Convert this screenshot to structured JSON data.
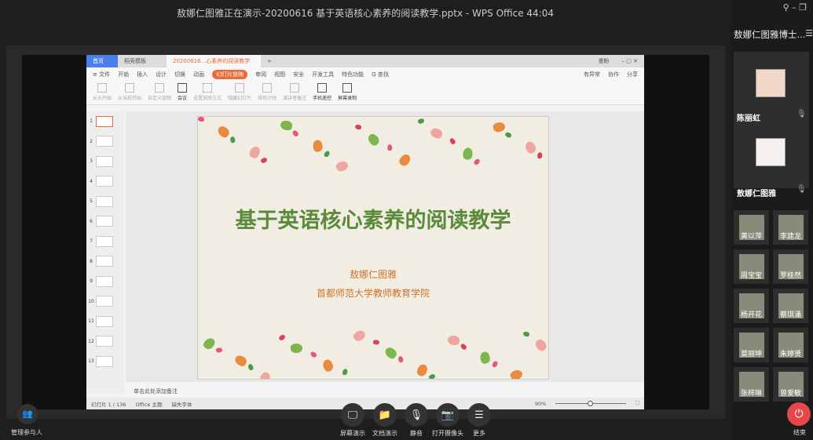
{
  "window_title": "敖娜仁图雅正在演示-20200616 基于英语核心素养的阅读教学.pptx - WPS Office 44:04",
  "wps": {
    "tabs": [
      {
        "label": "首页"
      },
      {
        "label": "稻壳模板"
      },
      {
        "label": "20200616...心素养的阅读教学"
      }
    ],
    "user": "墨盼",
    "menu": [
      "≡ 文件",
      "开始",
      "插入",
      "设计",
      "切换",
      "动画",
      "幻灯片放映",
      "审阅",
      "视图",
      "安全",
      "开发工具",
      "特色功能",
      "Q 查找"
    ],
    "menu_right": [
      "有异常",
      "协作",
      "分享"
    ],
    "ribbon": [
      {
        "label": "从头开始",
        "on": false
      },
      {
        "label": "从当前开始",
        "on": false
      },
      {
        "label": "自定义放映",
        "on": false
      },
      {
        "label": "会议",
        "on": true
      },
      {
        "label": "设置放映方式",
        "on": false
      },
      {
        "label": "隐藏幻灯片",
        "on": false
      },
      {
        "label": "排练计时",
        "on": false
      },
      {
        "label": "演讲者备注",
        "on": false
      },
      {
        "label": "手机遥控",
        "on": true
      },
      {
        "label": "屏幕录制",
        "on": true
      }
    ],
    "thumbnails": [
      "1",
      "2",
      "3",
      "4",
      "5",
      "6",
      "7",
      "8",
      "9",
      "10",
      "11",
      "12",
      "13"
    ],
    "slide": {
      "title": "基于英语核心素养的阅读教学",
      "author": "敖娜仁图雅",
      "org": "首都师范大学教师教育学院"
    },
    "notes_placeholder": "单击此处添加备注",
    "status": {
      "slide": "幻灯片 1 / 136",
      "theme": "Office 主题",
      "font": "缺失字体",
      "zoom": "90%"
    },
    "zoom_percent": 90
  },
  "sidebar": {
    "meeting_title": "敖娜仁图雅博士...",
    "speakers": [
      {
        "name": "陈丽虹"
      },
      {
        "name": "敖娜仁图雅"
      }
    ],
    "participants": [
      "黄以萍",
      "李建龙",
      "周宝宝",
      "罗桂然",
      "杨开花",
      "蔡琪涌",
      "莫丽坤",
      "朱婷贤",
      "张梓琳",
      "曾爱敏"
    ],
    "end_label": "结束"
  },
  "controls": {
    "manage": "管理参与人",
    "buttons": [
      "屏幕演示",
      "文档演示",
      "静音",
      "打开摄像头",
      "更多"
    ]
  },
  "colors": {
    "accent": "#e96b3a",
    "title_green": "#5b8a3a",
    "end_red": "#e8474a"
  }
}
